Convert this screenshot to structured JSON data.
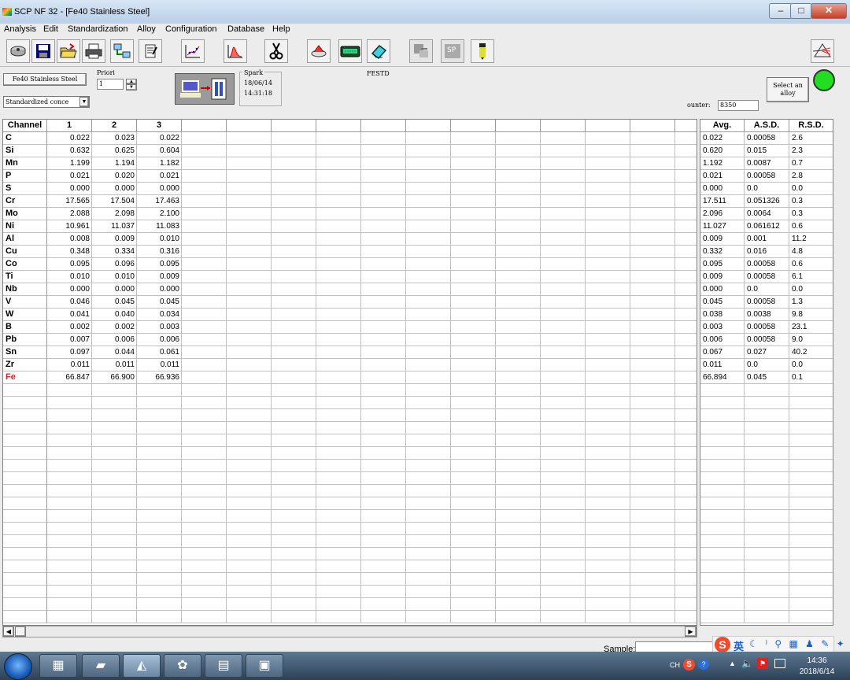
{
  "window": {
    "title": "SCP NF 32 - [Fe40 Stainless Steel]",
    "min": "–",
    "max": "□",
    "close": "✕"
  },
  "menu": [
    "Analysis",
    "Edit",
    "Standardization",
    "Alloy",
    "Configuration",
    "Database",
    "Help"
  ],
  "toolbar_icons": [
    "sample-icon",
    "save-icon",
    "open-folder-icon",
    "print-icon",
    "network-icon",
    "edit-script-icon",
    "calibration-curve-icon",
    "spectrum-icon",
    "cut-icon",
    "burn-icon",
    "instrument-icon",
    "eraser-icon",
    "transfer-icon",
    "sp-icon",
    "marker-icon",
    "prism-icon"
  ],
  "params": {
    "alloy_button": "Fe40 Stainless Steel",
    "priori_label": "Priori",
    "priori_value": "1",
    "mode_select": "Standardized conce",
    "spark_label": "Spark",
    "spark_date": "18/06/14",
    "spark_time": "14:31:18",
    "program": "FESTD",
    "select_alloy": "Select an alloy",
    "counter_label": "ounter:",
    "counter_value": "8350"
  },
  "accent": {
    "fe_color": "#e02020",
    "status_color": "#22dd22"
  },
  "table": {
    "headers": [
      "Channel",
      "1",
      "2",
      "3"
    ],
    "stat_headers": [
      "Avg.",
      "A.S.D.",
      "R.S.D."
    ],
    "rows": [
      {
        "el": "C",
        "v": [
          "0.022",
          "0.023",
          "0.022"
        ],
        "avg": "0.022",
        "asd": "0.00058",
        "rsd": "2.6"
      },
      {
        "el": "Si",
        "v": [
          "0.632",
          "0.625",
          "0.604"
        ],
        "avg": "0.620",
        "asd": "0.015",
        "rsd": "2.3"
      },
      {
        "el": "Mn",
        "v": [
          "1.199",
          "1.194",
          "1.182"
        ],
        "avg": "1.192",
        "asd": "0.0087",
        "rsd": "0.7"
      },
      {
        "el": "P",
        "v": [
          "0.021",
          "0.020",
          "0.021"
        ],
        "avg": "0.021",
        "asd": "0.00058",
        "rsd": "2.8"
      },
      {
        "el": "S",
        "v": [
          "0.000",
          "0.000",
          "0.000"
        ],
        "avg": "0.000",
        "asd": "0.0",
        "rsd": "0.0"
      },
      {
        "el": "Cr",
        "v": [
          "17.565",
          "17.504",
          "17.463"
        ],
        "avg": "17.511",
        "asd": "0.051326",
        "rsd": "0.3"
      },
      {
        "el": "Mo",
        "v": [
          "2.088",
          "2.098",
          "2.100"
        ],
        "avg": "2.096",
        "asd": "0.0064",
        "rsd": "0.3"
      },
      {
        "el": "Ni",
        "v": [
          "10.961",
          "11.037",
          "11.083"
        ],
        "avg": "11.027",
        "asd": "0.061612",
        "rsd": "0.6"
      },
      {
        "el": "Al",
        "v": [
          "0.008",
          "0.009",
          "0.010"
        ],
        "avg": "0.009",
        "asd": "0.001",
        "rsd": "11.2"
      },
      {
        "el": "Cu",
        "v": [
          "0.348",
          "0.334",
          "0.316"
        ],
        "avg": "0.332",
        "asd": "0.016",
        "rsd": "4.8"
      },
      {
        "el": "Co",
        "v": [
          "0.095",
          "0.096",
          "0.095"
        ],
        "avg": "0.095",
        "asd": "0.00058",
        "rsd": "0.6"
      },
      {
        "el": "Ti",
        "v": [
          "0.010",
          "0.010",
          "0.009"
        ],
        "avg": "0.009",
        "asd": "0.00058",
        "rsd": "6.1"
      },
      {
        "el": "Nb",
        "v": [
          "0.000",
          "0.000",
          "0.000"
        ],
        "avg": "0.000",
        "asd": "0.0",
        "rsd": "0.0"
      },
      {
        "el": "V",
        "v": [
          "0.046",
          "0.045",
          "0.045"
        ],
        "avg": "0.045",
        "asd": "0.00058",
        "rsd": "1.3"
      },
      {
        "el": "W",
        "v": [
          "0.041",
          "0.040",
          "0.034"
        ],
        "avg": "0.038",
        "asd": "0.0038",
        "rsd": "9.8"
      },
      {
        "el": "B",
        "v": [
          "0.002",
          "0.002",
          "0.003"
        ],
        "avg": "0.003",
        "asd": "0.00058",
        "rsd": "23.1"
      },
      {
        "el": "Pb",
        "v": [
          "0.007",
          "0.006",
          "0.006"
        ],
        "avg": "0.006",
        "asd": "0.00058",
        "rsd": "9.0"
      },
      {
        "el": "Sn",
        "v": [
          "0.097",
          "0.044",
          "0.061"
        ],
        "avg": "0.067",
        "asd": "0.027",
        "rsd": "40.2"
      },
      {
        "el": "Zr",
        "v": [
          "0.011",
          "0.011",
          "0.011"
        ],
        "avg": "0.011",
        "asd": "0.0",
        "rsd": "0.0"
      },
      {
        "el": "Fe",
        "v": [
          "66.847",
          "66.900",
          "66.936"
        ],
        "avg": "66.894",
        "asd": "0.045",
        "rsd": "0.1"
      }
    ]
  },
  "footer": {
    "sample_label": "Sample:"
  },
  "taskbar": {
    "apps": [
      "calculator-icon",
      "notes-icon",
      "prism-app-icon",
      "paint-icon",
      "explorer-icon",
      "monitor-icon"
    ],
    "lang": "CH",
    "ime_label": "英",
    "time": "14:36",
    "date": "2018/6/14"
  }
}
